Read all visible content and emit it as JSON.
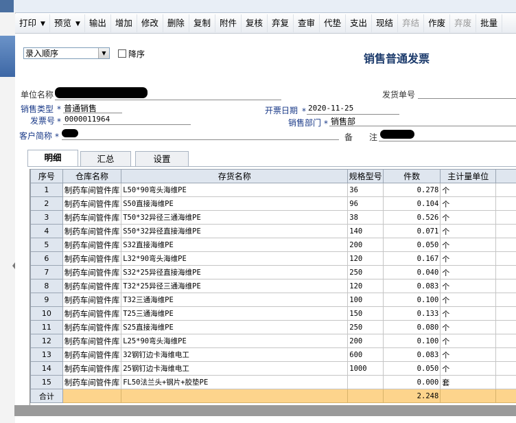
{
  "toolbar": {
    "items": [
      {
        "label": "打印",
        "dropdown": true,
        "enabled": true
      },
      {
        "label": "预览",
        "dropdown": true,
        "enabled": true
      },
      {
        "label": "输出",
        "enabled": true
      },
      {
        "label": "增加",
        "enabled": true
      },
      {
        "label": "修改",
        "enabled": true
      },
      {
        "label": "删除",
        "enabled": true
      },
      {
        "label": "复制",
        "enabled": true
      },
      {
        "label": "附件",
        "enabled": true
      },
      {
        "label": "复核",
        "enabled": true
      },
      {
        "label": "弃复",
        "enabled": true
      },
      {
        "label": "查审",
        "enabled": true
      },
      {
        "label": "代垫",
        "enabled": true
      },
      {
        "label": "支出",
        "enabled": true
      },
      {
        "label": "现结",
        "enabled": true
      },
      {
        "label": "弃结",
        "enabled": false
      },
      {
        "label": "作废",
        "enabled": true
      },
      {
        "label": "弃废",
        "enabled": false
      },
      {
        "label": "批量",
        "enabled": true
      }
    ]
  },
  "header": {
    "sort_select": "录入顺序",
    "desc_label": "降序",
    "desc_checked": false,
    "title": "销售普通发票"
  },
  "form": {
    "unit_name_label": "单位名称",
    "ship_no_label": "发货单号",
    "sales_type_label": "销售类型",
    "sales_type_value": "普通销售",
    "invoice_date_label": "开票日期",
    "invoice_date_value": "2020-11-25",
    "invoice_no_label": "发票号",
    "invoice_no_value": "0000011964",
    "dept_label": "销售部门",
    "dept_value": "销售部",
    "customer_label": "客户简称",
    "remark_label_1": "备",
    "remark_label_2": "注",
    "required_mark": "*"
  },
  "tabs": [
    "明细",
    "汇总",
    "设置"
  ],
  "grid": {
    "columns": [
      "序号",
      "仓库名称",
      "存货名称",
      "规格型号",
      "件数",
      "主计量单位"
    ],
    "rows": [
      {
        "no": "1",
        "warehouse": "制药车间管件库",
        "item": "L50*90弯头海维PE",
        "spec": "36",
        "qty": "0.278",
        "unit": "个"
      },
      {
        "no": "2",
        "warehouse": "制药车间管件库",
        "item": "S50直接海维PE",
        "spec": "96",
        "qty": "0.104",
        "unit": "个"
      },
      {
        "no": "3",
        "warehouse": "制药车间管件库",
        "item": "T50*32异径三通海维PE",
        "spec": "38",
        "qty": "0.526",
        "unit": "个"
      },
      {
        "no": "4",
        "warehouse": "制药车间管件库",
        "item": "S50*32异径直接海维PE",
        "spec": "140",
        "qty": "0.071",
        "unit": "个"
      },
      {
        "no": "5",
        "warehouse": "制药车间管件库",
        "item": "S32直接海维PE",
        "spec": "200",
        "qty": "0.050",
        "unit": "个"
      },
      {
        "no": "6",
        "warehouse": "制药车间管件库",
        "item": "L32*90弯头海维PE",
        "spec": "120",
        "qty": "0.167",
        "unit": "个"
      },
      {
        "no": "7",
        "warehouse": "制药车间管件库",
        "item": "S32*25异径直接海维PE",
        "spec": "250",
        "qty": "0.040",
        "unit": "个"
      },
      {
        "no": "8",
        "warehouse": "制药车间管件库",
        "item": "T32*25异径三通海维PE",
        "spec": "120",
        "qty": "0.083",
        "unit": "个"
      },
      {
        "no": "9",
        "warehouse": "制药车间管件库",
        "item": "T32三通海维PE",
        "spec": "100",
        "qty": "0.100",
        "unit": "个"
      },
      {
        "no": "10",
        "warehouse": "制药车间管件库",
        "item": "T25三通海维PE",
        "spec": "150",
        "qty": "0.133",
        "unit": "个"
      },
      {
        "no": "11",
        "warehouse": "制药车间管件库",
        "item": "S25直接海维PE",
        "spec": "250",
        "qty": "0.080",
        "unit": "个"
      },
      {
        "no": "12",
        "warehouse": "制药车间管件库",
        "item": "L25*90弯头海维PE",
        "spec": "200",
        "qty": "0.100",
        "unit": "个"
      },
      {
        "no": "13",
        "warehouse": "制药车间管件库",
        "item": "32钢钉边卡海维电工",
        "spec": "600",
        "qty": "0.083",
        "unit": "个"
      },
      {
        "no": "14",
        "warehouse": "制药车间管件库",
        "item": "25钢钉边卡海维电工",
        "spec": "1000",
        "qty": "0.050",
        "unit": "个"
      },
      {
        "no": "15",
        "warehouse": "制药车间管件库",
        "item": "FL50法兰头+钢片+胶垫PE",
        "spec": "",
        "qty": "0.000",
        "unit": "套"
      }
    ],
    "total_label": "合计",
    "total_qty": "2.248"
  },
  "colors": {
    "title": "#1b3a6b",
    "required_label": "#1a3a88",
    "total_row": "#fdd48c",
    "header_cell": "#dfe6ef"
  }
}
